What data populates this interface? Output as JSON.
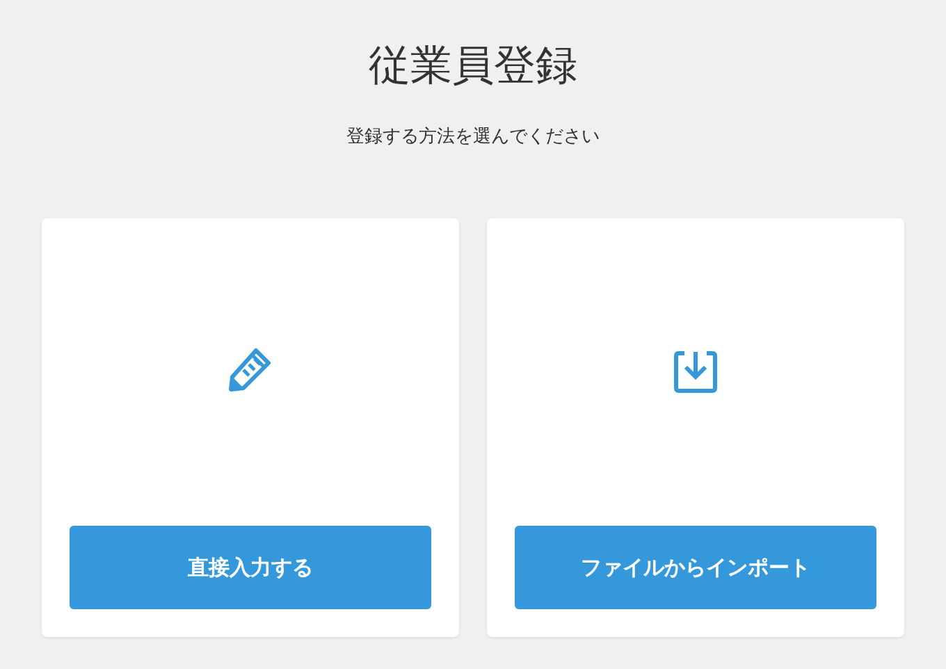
{
  "title": "従業員登録",
  "subtitle": "登録する方法を選んでください",
  "options": [
    {
      "kind": "manual",
      "button": "直接入力する"
    },
    {
      "kind": "import",
      "button": "ファイルからインポート"
    }
  ]
}
